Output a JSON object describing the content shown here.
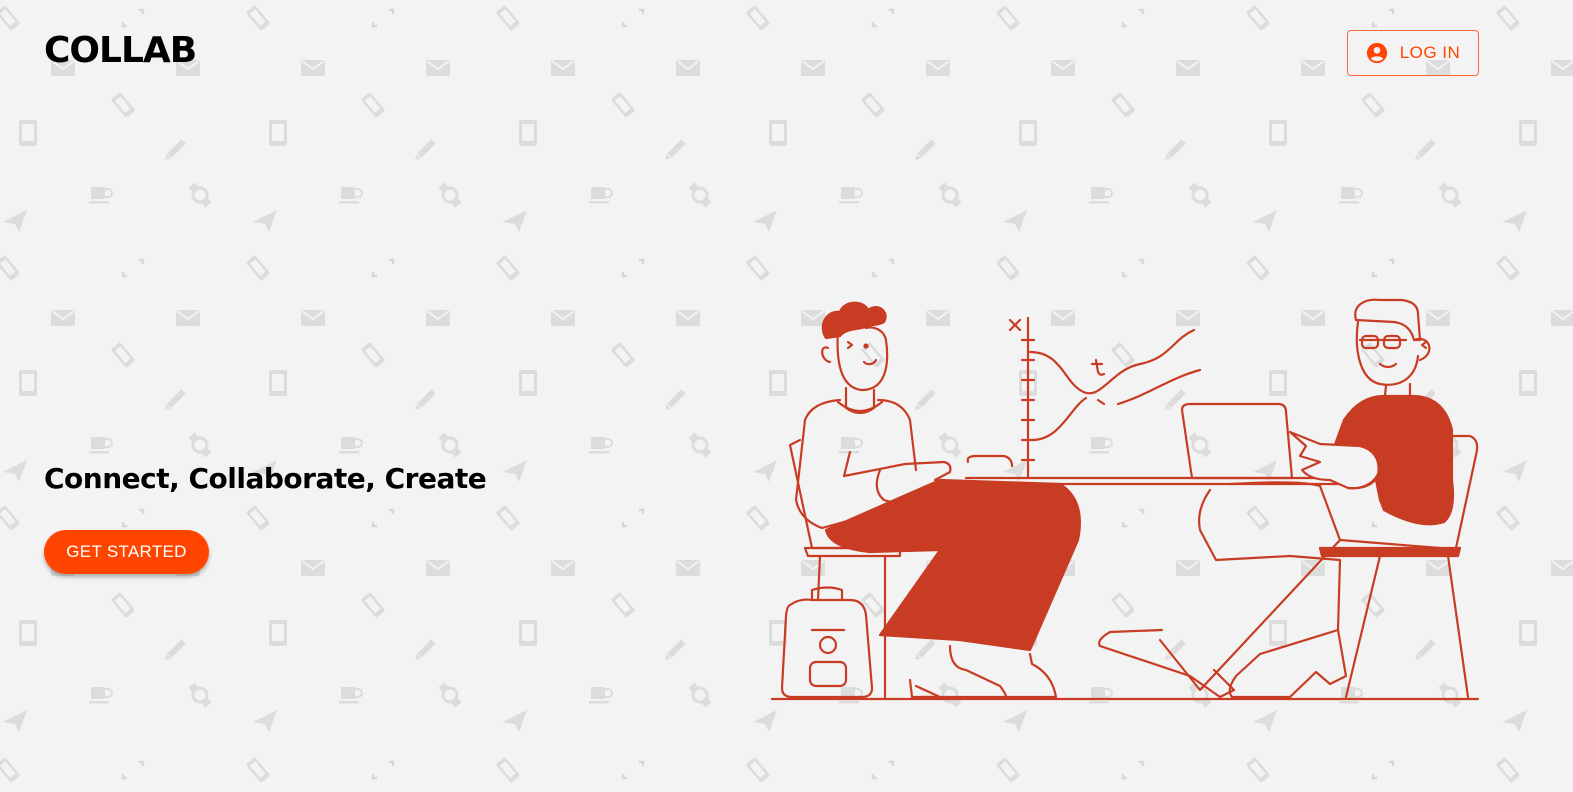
{
  "header": {
    "brand": "COLLAB",
    "login_label": "LOG IN",
    "login_icon": "account-circle-icon"
  },
  "hero": {
    "headline": "Connect, Collaborate, Create",
    "cta_label": "GET STARTED"
  },
  "background_pattern": {
    "icons": [
      "tablet-icon",
      "pencil-icon",
      "mug-icon",
      "paper-plane-icon",
      "expand-icon",
      "phone-icon",
      "envelope-icon",
      "watch-icon"
    ]
  },
  "illustration": {
    "name": "two-people-collaborating",
    "graph_labels": [
      "x",
      "t"
    ]
  },
  "colors": {
    "accent": "#ff4500",
    "illustration": "#c83c24",
    "background": "#f3f3f3",
    "pattern": "#dcdcdc"
  }
}
